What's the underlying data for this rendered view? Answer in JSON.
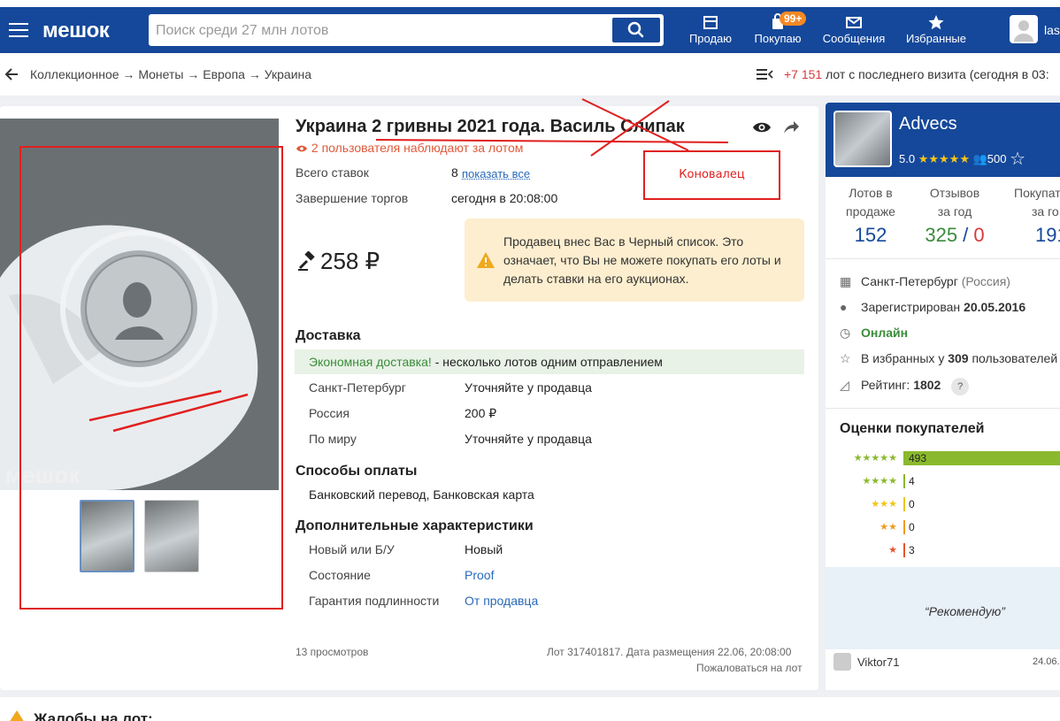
{
  "header": {
    "logo": "мешок",
    "search_placeholder": "Поиск среди 27 млн лотов",
    "nav": {
      "sell": "Продаю",
      "buy": "Покупаю",
      "buy_badge": "99+",
      "messages": "Сообщения",
      "favorites": "Избранные"
    },
    "user": "las"
  },
  "breadcrumbs": [
    "Коллекционное",
    "Монеты",
    "Европа",
    "Украина"
  ],
  "breadcrumb_sep": " → ",
  "visit": {
    "count": "+7 151",
    "text": " лот с последнего визита (сегодня в 03:"
  },
  "lot": {
    "title": "Украина 2 гривны 2021 года. Василь Слипак",
    "watchers": "2 пользователя наблюдают за лотом",
    "bids_label": "Всего ставок",
    "bids_value": "8",
    "bids_link": "показать все",
    "end_label": "Завершение торгов",
    "end_value": "сегодня в 20:08:00",
    "price": "258 ₽",
    "blacklist_warning": "Продавец внес Вас в Черный список. Это означает, что Вы не можете покупать его лоты и делать ставки на его аукционах.",
    "photo_watermark": "мешок",
    "delivery": {
      "heading": "Доставка",
      "econ_bold": "Экономная доставка!",
      "econ_rest": " - несколько лотов одним отправлением",
      "rows": [
        {
          "label": "Санкт-Петербург",
          "value": "Уточняйте у продавца"
        },
        {
          "label": "Россия",
          "value": "200 ₽"
        },
        {
          "label": "По миру",
          "value": "Уточняйте у продавца"
        }
      ]
    },
    "payment": {
      "heading": "Способы оплаты",
      "value": "Банковский перевод, Банковская карта"
    },
    "extra": {
      "heading": "Дополнительные характеристики",
      "rows": [
        {
          "label": "Новый или Б/У",
          "value": "Новый"
        },
        {
          "label": "Состояние",
          "value": "Proof"
        },
        {
          "label": "Гарантия подлинности",
          "value": "От продавца"
        }
      ]
    },
    "views": "13 просмотров",
    "lot_info": "Лот 317401817. Дата размещения 22.06, 20:08:00",
    "complain": "Пожаловаться на лот"
  },
  "annotation": {
    "correction": "Коновалец"
  },
  "seller": {
    "name": "Advecs",
    "rating": "5.0",
    "stars": "★★★★★",
    "followers": "500",
    "stats": [
      {
        "label_1": "Лотов в",
        "label_2": "продаже",
        "value": "152"
      },
      {
        "label_1": "Отзывов",
        "label_2": "за год",
        "value_pos": "325",
        "value_sep": " / ",
        "value_neg": "0"
      },
      {
        "label_1": "Покупат",
        "label_2": "за го",
        "value": "191"
      }
    ],
    "city": "Санкт-Петербург",
    "country": "(Россия)",
    "registered_label": "Зарегистрирован ",
    "registered_date": "20.05.2016",
    "online": "Онлайн",
    "fav_prefix": "В избранных у ",
    "fav_count": "309",
    "fav_suffix": " пользователей",
    "rating_label": "Рейтинг: ",
    "rating_value": "1802",
    "rating_help": "?",
    "buyer_ratings_heading": "Оценки покупателей",
    "buyer_ratings": [
      {
        "stars": "★★★★★",
        "count": 493,
        "label": "493",
        "color": "#8ab92d"
      },
      {
        "stars": "★★★★",
        "count": 4,
        "label": "4",
        "color": "#8ab92d"
      },
      {
        "stars": "★★★",
        "count": 0,
        "label": "0",
        "color": "#f0c419"
      },
      {
        "stars": "★★",
        "count": 0,
        "label": "0",
        "color": "#f09a24"
      },
      {
        "stars": "★",
        "count": 3,
        "label": "3",
        "color": "#e8552d"
      }
    ],
    "review_quote": "“Рекомендую”",
    "reviewer": "Viktor71",
    "review_date": "24.06."
  },
  "bottom": {
    "complaints": "Жалобы на лот:"
  },
  "colors": {
    "brand": "#15489a",
    "price_up": "#d83a3a",
    "annotation_red": "#e0201f"
  }
}
